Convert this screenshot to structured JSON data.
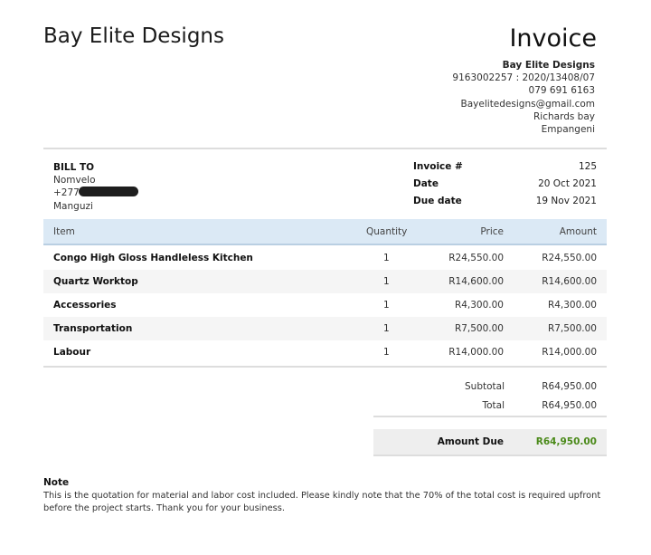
{
  "header": {
    "company_name": "Bay Elite Designs",
    "doc_title": "Invoice"
  },
  "from": {
    "name": "Bay Elite Designs",
    "reg": "9163002257 : 2020/13408/07",
    "phone": "079 691 6163",
    "email": "Bayelitedesigns@gmail.com",
    "area": "Richards bay",
    "city": "Empangeni"
  },
  "bill_to": {
    "label": "BILL TO",
    "name": "Nomvelo",
    "phone_visible": "+277",
    "location": "Manguzi"
  },
  "meta": {
    "invoice_label": "Invoice #",
    "invoice_value": "125",
    "date_label": "Date",
    "date_value": "20 Oct 2021",
    "due_label": "Due date",
    "due_value": "19 Nov 2021"
  },
  "table": {
    "headers": {
      "item": "Item",
      "quantity": "Quantity",
      "price": "Price",
      "amount": "Amount"
    },
    "rows": [
      {
        "item": "Congo High Gloss Handleless Kitchen",
        "qty": "1",
        "price": "R24,550.00",
        "amount": "R24,550.00"
      },
      {
        "item": "Quartz Worktop",
        "qty": "1",
        "price": "R14,600.00",
        "amount": "R14,600.00"
      },
      {
        "item": "Accessories",
        "qty": "1",
        "price": "R4,300.00",
        "amount": "R4,300.00"
      },
      {
        "item": "Transportation",
        "qty": "1",
        "price": "R7,500.00",
        "amount": "R7,500.00"
      },
      {
        "item": "Labour",
        "qty": "1",
        "price": "R14,000.00",
        "amount": "R14,000.00"
      }
    ]
  },
  "totals": {
    "subtotal_label": "Subtotal",
    "subtotal_value": "R64,950.00",
    "total_label": "Total",
    "total_value": "R64,950.00",
    "amount_due_label": "Amount Due",
    "amount_due_value": "R64,950.00"
  },
  "note": {
    "title": "Note",
    "text": "This is the quotation for material and labor cost included. Please kindly note that the 70% of the total cost is required upfront before the project starts. Thank you for your business."
  },
  "colors": {
    "header_row_bg": "#dbe9f5",
    "amount_due": "#4b8a1a",
    "redaction": "#1e1e1e"
  }
}
